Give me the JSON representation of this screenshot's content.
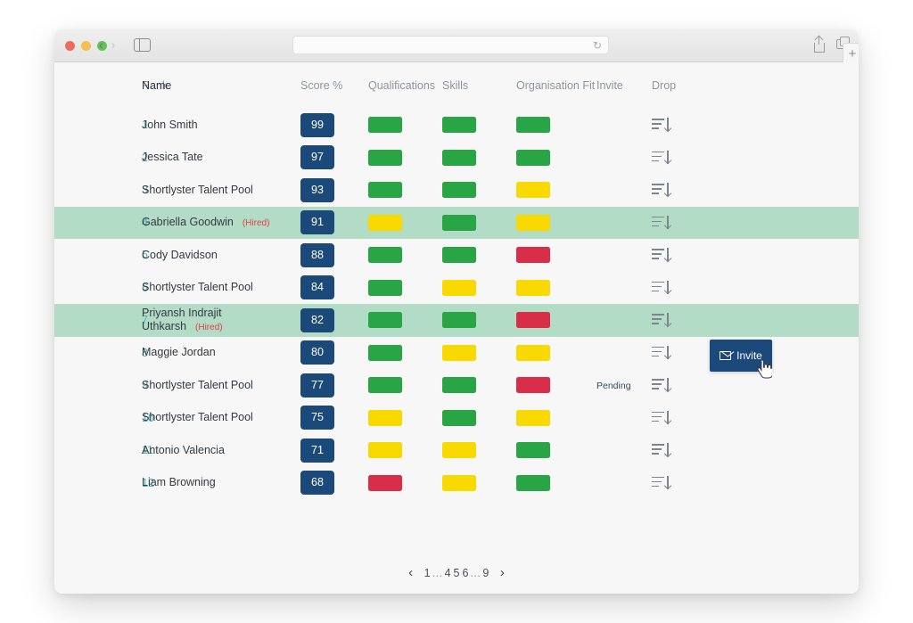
{
  "browser": {
    "url_value": "",
    "url_placeholder": "",
    "reload_glyph": "↻",
    "back_glyph": "‹",
    "forward_glyph": "›",
    "new_tab_label": "+",
    "icons": {
      "share": "share-icon",
      "tabs": "tabs-overview-icon",
      "sidebar": "sidebar-toggle-icon",
      "reload": "reload-icon"
    }
  },
  "table": {
    "headers": {
      "rank": "Rank",
      "name": "Name",
      "score": "Score %",
      "qualifications": "Qualifications",
      "skills": "Skills",
      "organisation_fit": "Organisation Fit",
      "invite": "Invite",
      "drop": "Drop"
    },
    "rows": [
      {
        "rank": "1",
        "name": "John Smith",
        "name2": "",
        "hired": "",
        "score": "99",
        "qualifications": "green",
        "skills": "green",
        "organisation_fit": "green",
        "invite_status": "",
        "highlighted": false
      },
      {
        "rank": "2",
        "name": "Jessica Tate",
        "name2": "",
        "hired": "",
        "score": "97",
        "qualifications": "green",
        "skills": "green",
        "organisation_fit": "green",
        "invite_status": "",
        "highlighted": false
      },
      {
        "rank": "3",
        "name": "Shortlyster Talent Pool",
        "name2": "",
        "hired": "",
        "score": "93",
        "qualifications": "green",
        "skills": "green",
        "organisation_fit": "yellow",
        "invite_status": "",
        "highlighted": false
      },
      {
        "rank": "4",
        "name": "Gabriella Goodwin",
        "name2": "",
        "hired": "(Hired)",
        "score": "91",
        "qualifications": "yellow",
        "skills": "green",
        "organisation_fit": "yellow",
        "invite_status": "",
        "highlighted": true
      },
      {
        "rank": "5",
        "name": "Cody Davidson",
        "name2": "",
        "hired": "",
        "score": "88",
        "qualifications": "green",
        "skills": "green",
        "organisation_fit": "red",
        "invite_status": "",
        "highlighted": false
      },
      {
        "rank": "6",
        "name": "Shortlyster Talent Pool",
        "name2": "",
        "hired": "",
        "score": "84",
        "qualifications": "green",
        "skills": "yellow",
        "organisation_fit": "yellow",
        "invite_status": "",
        "highlighted": false
      },
      {
        "rank": "7",
        "name": "Priyansh Indrajit",
        "name2": "Uthkarsh",
        "hired": "(Hired)",
        "score": "82",
        "qualifications": "green",
        "skills": "green",
        "organisation_fit": "red",
        "invite_status": "",
        "highlighted": true
      },
      {
        "rank": "8",
        "name": "Maggie Jordan",
        "name2": "",
        "hired": "",
        "score": "80",
        "qualifications": "green",
        "skills": "yellow",
        "organisation_fit": "yellow",
        "invite_status": "",
        "highlighted": false
      },
      {
        "rank": "9",
        "name": "Shortlyster Talent Pool",
        "name2": "",
        "hired": "",
        "score": "77",
        "qualifications": "green",
        "skills": "green",
        "organisation_fit": "red",
        "invite_status": "Pending",
        "highlighted": false
      },
      {
        "rank": "10",
        "name": "Shortlyster Talent Pool",
        "name2": "",
        "hired": "",
        "score": "75",
        "qualifications": "yellow",
        "skills": "green",
        "organisation_fit": "yellow",
        "invite_status": "",
        "highlighted": false
      },
      {
        "rank": "11",
        "name": "Antonio Valencia",
        "name2": "",
        "hired": "",
        "score": "71",
        "qualifications": "yellow",
        "skills": "yellow",
        "organisation_fit": "green",
        "invite_status": "",
        "highlighted": false
      },
      {
        "rank": "12",
        "name": "Liam Browning",
        "name2": "",
        "hired": "",
        "score": "68",
        "qualifications": "red",
        "skills": "yellow",
        "organisation_fit": "green",
        "invite_status": "",
        "highlighted": false
      }
    ]
  },
  "invite_button": {
    "label": "Invite",
    "icon": "envelope-icon"
  },
  "pagination": {
    "prev_glyph": "‹",
    "next_glyph": "›",
    "items": [
      "1",
      "…",
      "4",
      "5",
      "6",
      "…",
      "9"
    ],
    "current": "5"
  },
  "colors": {
    "green": "#2aa546",
    "yellow": "#f8d900",
    "red": "#d92e48",
    "score_badge": "#1b4a7a",
    "rank": "#4eaec0",
    "hired_tag": "#e0403f",
    "row_highlight": "#b3dcc7",
    "page_bg": "#f7f7f7"
  }
}
